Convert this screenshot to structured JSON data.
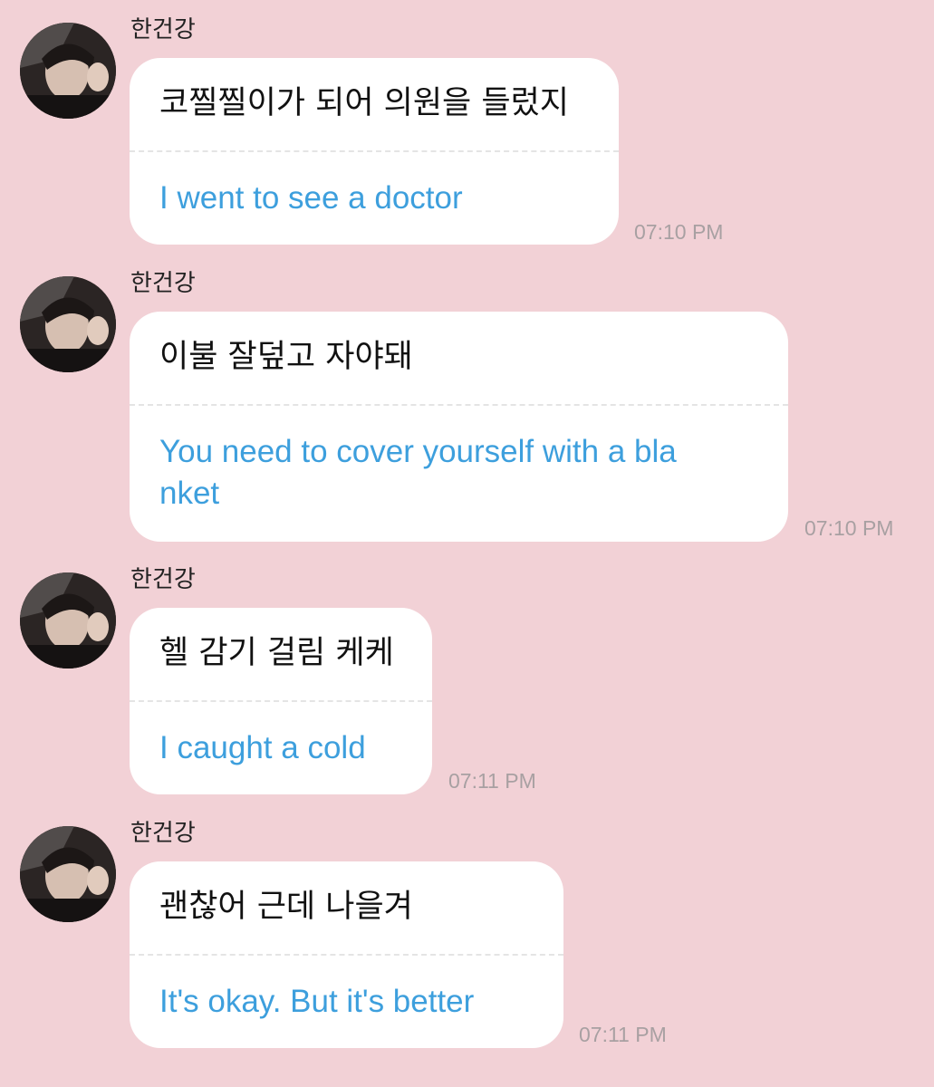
{
  "messages": [
    {
      "sender": "한건강",
      "original": "코찔찔이가 되어 의원을 들렀지",
      "translation": "I went to see a doctor",
      "time": "07:10 PM"
    },
    {
      "sender": "한건강",
      "original": "이불 잘덮고 자야돼",
      "translation": "You need to cover yourself with a bla\nnket",
      "time": "07:10 PM"
    },
    {
      "sender": "한건강",
      "original": "헬 감기 걸림 케케",
      "translation": "I caught a cold",
      "time": "07:11 PM"
    },
    {
      "sender": "한건강",
      "original": "괜찮어 근데 나을겨",
      "translation": "It's okay. But it's better",
      "time": "07:11 PM"
    }
  ],
  "colors": {
    "background": "#f2d1d6",
    "bubble": "#ffffff",
    "translation_text": "#3d9fdd",
    "timestamp_text": "#a8a0a2"
  },
  "icons": {
    "avatar": "profile-photo"
  }
}
